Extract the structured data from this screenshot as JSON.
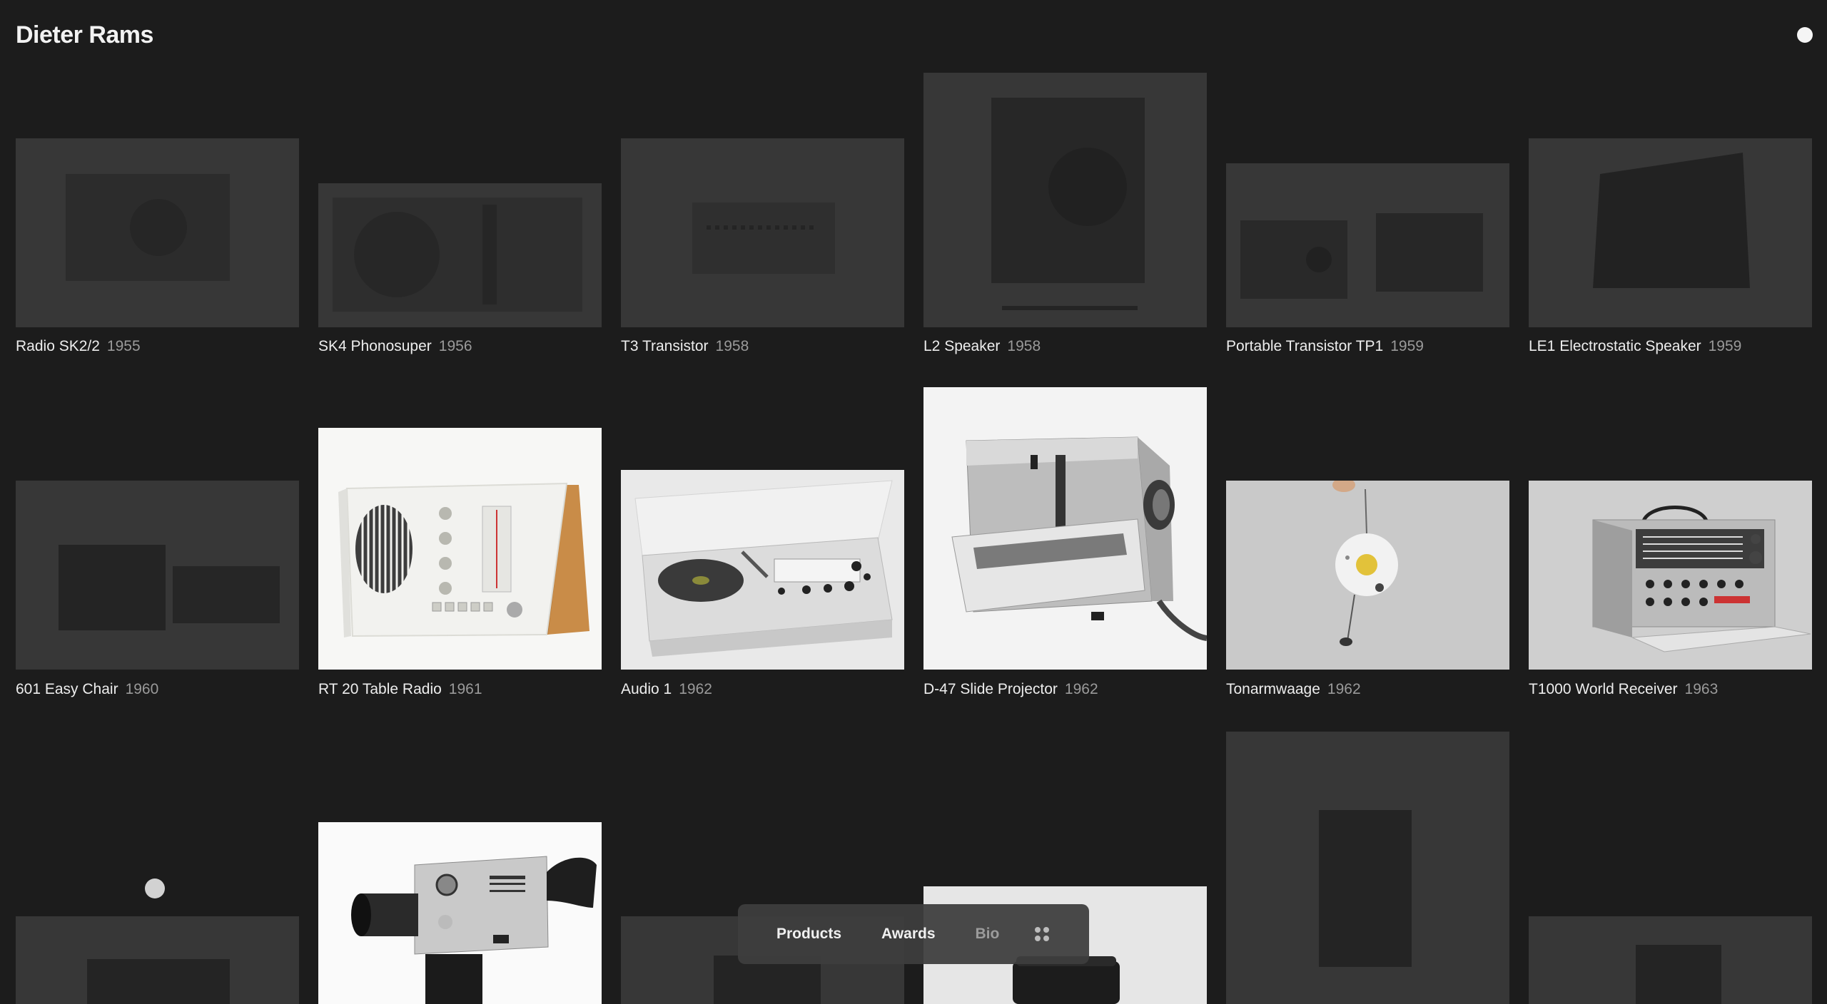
{
  "header": {
    "title": "Dieter Rams"
  },
  "products": [
    {
      "name": "Radio SK2/2",
      "year": "1955"
    },
    {
      "name": "SK4 Phonosuper",
      "year": "1956"
    },
    {
      "name": "T3 Transistor",
      "year": "1958"
    },
    {
      "name": "L2 Speaker",
      "year": "1958"
    },
    {
      "name": "Portable Transistor TP1",
      "year": "1959"
    },
    {
      "name": "LE1 Electrostatic Speaker",
      "year": "1959"
    },
    {
      "name": "601 Easy Chair",
      "year": "1960"
    },
    {
      "name": "RT 20 Table Radio",
      "year": "1961"
    },
    {
      "name": "Audio 1",
      "year": "1962"
    },
    {
      "name": "D-47 Slide Projector",
      "year": "1962"
    },
    {
      "name": "Tonarmwaage",
      "year": "1962"
    },
    {
      "name": "T1000 World Receiver",
      "year": "1963"
    }
  ],
  "nav": {
    "products_label": "Products",
    "awards_label": "Awards",
    "bio_label": "Bio"
  },
  "icons": {
    "grid_view": "grid-icon",
    "status": "status-dot-icon"
  },
  "colors": {
    "background": "#1c1c1c",
    "text": "#ededed",
    "year_text": "#9a9a9a",
    "nav_background": "#3e3e3e"
  }
}
